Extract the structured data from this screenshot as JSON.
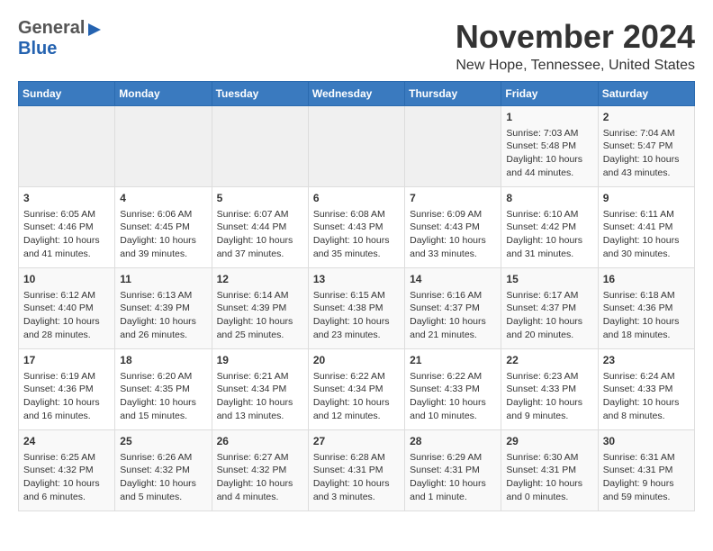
{
  "header": {
    "logo_general": "General",
    "logo_blue": "Blue",
    "month_title": "November 2024",
    "location": "New Hope, Tennessee, United States"
  },
  "days_of_week": [
    "Sunday",
    "Monday",
    "Tuesday",
    "Wednesday",
    "Thursday",
    "Friday",
    "Saturday"
  ],
  "weeks": [
    [
      {
        "day": "",
        "info": ""
      },
      {
        "day": "",
        "info": ""
      },
      {
        "day": "",
        "info": ""
      },
      {
        "day": "",
        "info": ""
      },
      {
        "day": "",
        "info": ""
      },
      {
        "day": "1",
        "info": "Sunrise: 7:03 AM\nSunset: 5:48 PM\nDaylight: 10 hours\nand 44 minutes."
      },
      {
        "day": "2",
        "info": "Sunrise: 7:04 AM\nSunset: 5:47 PM\nDaylight: 10 hours\nand 43 minutes."
      }
    ],
    [
      {
        "day": "3",
        "info": "Sunrise: 6:05 AM\nSunset: 4:46 PM\nDaylight: 10 hours\nand 41 minutes."
      },
      {
        "day": "4",
        "info": "Sunrise: 6:06 AM\nSunset: 4:45 PM\nDaylight: 10 hours\nand 39 minutes."
      },
      {
        "day": "5",
        "info": "Sunrise: 6:07 AM\nSunset: 4:44 PM\nDaylight: 10 hours\nand 37 minutes."
      },
      {
        "day": "6",
        "info": "Sunrise: 6:08 AM\nSunset: 4:43 PM\nDaylight: 10 hours\nand 35 minutes."
      },
      {
        "day": "7",
        "info": "Sunrise: 6:09 AM\nSunset: 4:43 PM\nDaylight: 10 hours\nand 33 minutes."
      },
      {
        "day": "8",
        "info": "Sunrise: 6:10 AM\nSunset: 4:42 PM\nDaylight: 10 hours\nand 31 minutes."
      },
      {
        "day": "9",
        "info": "Sunrise: 6:11 AM\nSunset: 4:41 PM\nDaylight: 10 hours\nand 30 minutes."
      }
    ],
    [
      {
        "day": "10",
        "info": "Sunrise: 6:12 AM\nSunset: 4:40 PM\nDaylight: 10 hours\nand 28 minutes."
      },
      {
        "day": "11",
        "info": "Sunrise: 6:13 AM\nSunset: 4:39 PM\nDaylight: 10 hours\nand 26 minutes."
      },
      {
        "day": "12",
        "info": "Sunrise: 6:14 AM\nSunset: 4:39 PM\nDaylight: 10 hours\nand 25 minutes."
      },
      {
        "day": "13",
        "info": "Sunrise: 6:15 AM\nSunset: 4:38 PM\nDaylight: 10 hours\nand 23 minutes."
      },
      {
        "day": "14",
        "info": "Sunrise: 6:16 AM\nSunset: 4:37 PM\nDaylight: 10 hours\nand 21 minutes."
      },
      {
        "day": "15",
        "info": "Sunrise: 6:17 AM\nSunset: 4:37 PM\nDaylight: 10 hours\nand 20 minutes."
      },
      {
        "day": "16",
        "info": "Sunrise: 6:18 AM\nSunset: 4:36 PM\nDaylight: 10 hours\nand 18 minutes."
      }
    ],
    [
      {
        "day": "17",
        "info": "Sunrise: 6:19 AM\nSunset: 4:36 PM\nDaylight: 10 hours\nand 16 minutes."
      },
      {
        "day": "18",
        "info": "Sunrise: 6:20 AM\nSunset: 4:35 PM\nDaylight: 10 hours\nand 15 minutes."
      },
      {
        "day": "19",
        "info": "Sunrise: 6:21 AM\nSunset: 4:34 PM\nDaylight: 10 hours\nand 13 minutes."
      },
      {
        "day": "20",
        "info": "Sunrise: 6:22 AM\nSunset: 4:34 PM\nDaylight: 10 hours\nand 12 minutes."
      },
      {
        "day": "21",
        "info": "Sunrise: 6:22 AM\nSunset: 4:33 PM\nDaylight: 10 hours\nand 10 minutes."
      },
      {
        "day": "22",
        "info": "Sunrise: 6:23 AM\nSunset: 4:33 PM\nDaylight: 10 hours\nand 9 minutes."
      },
      {
        "day": "23",
        "info": "Sunrise: 6:24 AM\nSunset: 4:33 PM\nDaylight: 10 hours\nand 8 minutes."
      }
    ],
    [
      {
        "day": "24",
        "info": "Sunrise: 6:25 AM\nSunset: 4:32 PM\nDaylight: 10 hours\nand 6 minutes."
      },
      {
        "day": "25",
        "info": "Sunrise: 6:26 AM\nSunset: 4:32 PM\nDaylight: 10 hours\nand 5 minutes."
      },
      {
        "day": "26",
        "info": "Sunrise: 6:27 AM\nSunset: 4:32 PM\nDaylight: 10 hours\nand 4 minutes."
      },
      {
        "day": "27",
        "info": "Sunrise: 6:28 AM\nSunset: 4:31 PM\nDaylight: 10 hours\nand 3 minutes."
      },
      {
        "day": "28",
        "info": "Sunrise: 6:29 AM\nSunset: 4:31 PM\nDaylight: 10 hours\nand 1 minute."
      },
      {
        "day": "29",
        "info": "Sunrise: 6:30 AM\nSunset: 4:31 PM\nDaylight: 10 hours\nand 0 minutes."
      },
      {
        "day": "30",
        "info": "Sunrise: 6:31 AM\nSunset: 4:31 PM\nDaylight: 9 hours\nand 59 minutes."
      }
    ]
  ]
}
